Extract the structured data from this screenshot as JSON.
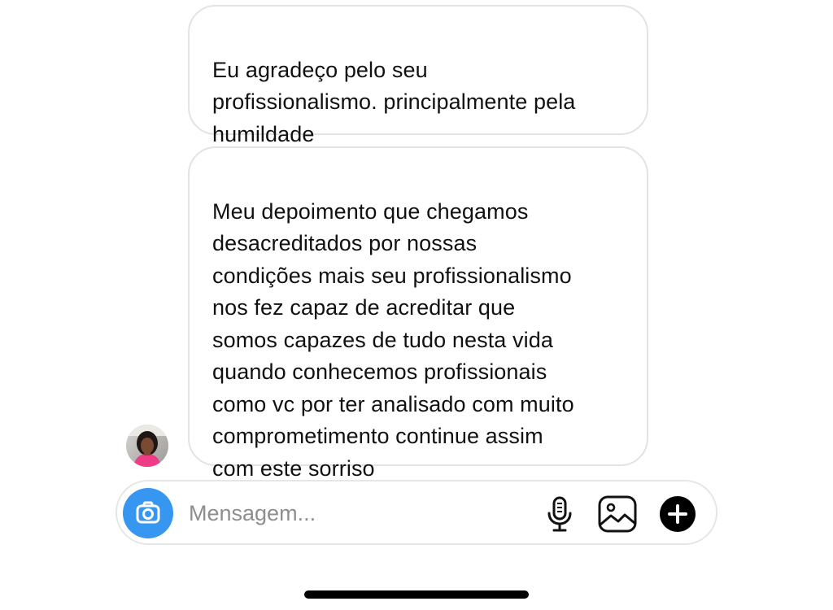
{
  "thread": {
    "messages": [
      {
        "text": "Eu agradeço pelo seu\nprofissionalismo. principalmente pela\nhumildade"
      },
      {
        "text": "Meu depoimento que chegamos\ndesacreditados por nossas\ncondições mais seu profissionalismo\nnos fez capaz de acreditar que\nsomos capazes de tudo nesta vida\nquando conhecemos profissionais\ncomo vc por ter analisado com muito\ncomprometimento continue assim\ncom este sorriso"
      }
    ]
  },
  "composer": {
    "placeholder": "Mensagem...",
    "value": "",
    "camera_icon": "camera-icon",
    "mic_icon": "microphone-icon",
    "gallery_icon": "gallery-icon",
    "plus_icon": "plus-icon"
  },
  "colors": {
    "camera_button": "#3797f0",
    "bubble_border": "#e3e3e3",
    "placeholder": "#8e8e8e"
  }
}
